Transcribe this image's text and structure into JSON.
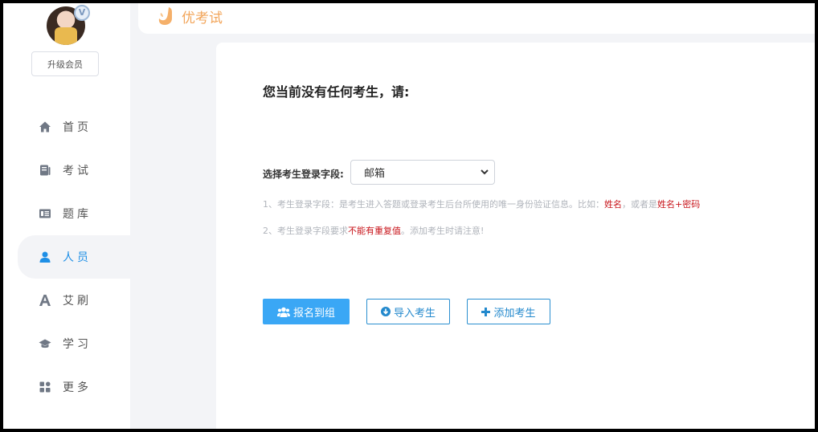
{
  "sidebar": {
    "vip_badge": "V",
    "upgrade_label": "升级会员",
    "items": [
      {
        "label": "首页",
        "icon": "home-icon"
      },
      {
        "label": "考试",
        "icon": "exam-icon"
      },
      {
        "label": "题库",
        "icon": "question-bank-icon"
      },
      {
        "label": "人员",
        "icon": "person-icon",
        "active": true
      },
      {
        "label": "艾刷",
        "icon": "letter-a-icon"
      },
      {
        "label": "学习",
        "icon": "graduation-cap-icon"
      },
      {
        "label": "更多",
        "icon": "grid-icon"
      }
    ]
  },
  "topbar": {
    "logo_text": "优考试"
  },
  "main": {
    "heading": "您当前没有任何考生，请:",
    "field_label": "选择考生登录字段:",
    "select_value": "邮箱",
    "note1": {
      "prefix": "1、考生登录字段：是考生进入答题或登录考生后台所使用的唯一身份验证信息。比如：",
      "red1": "姓名",
      "mid": "，或者是",
      "red2": "姓名+密码",
      "suffix": ""
    },
    "note2": {
      "prefix": "2、考生登录字段要求",
      "red": "不能有重复值",
      "suffix": "。添加考生时请注意!"
    },
    "buttons": {
      "signup_label": "报名到组",
      "import_label": "导入考生",
      "add_label": "添加考生"
    }
  },
  "colors": {
    "accent": "#3aa7f5",
    "active_nav": "#1e8fe6",
    "logo": "#f2a55a",
    "warning_red": "#c8151b"
  }
}
